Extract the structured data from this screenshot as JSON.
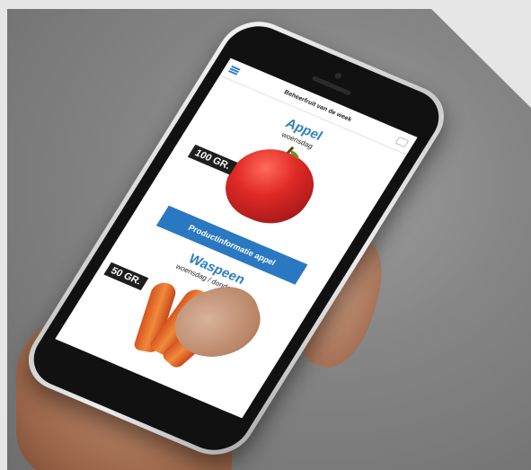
{
  "app": {
    "header_title": "Beheerfruit van de week",
    "menu_icon": "menu-icon",
    "share_icon": "share-icon"
  },
  "products": [
    {
      "name": "Appel",
      "days": "woensdag",
      "weight": "100 GR.",
      "image": "apple-image",
      "button_label": "Productinformatie appel"
    },
    {
      "name": "Waspeen",
      "days": "woensdag / donderdag",
      "weight": "50 GR.",
      "image": "carrot-image"
    }
  ],
  "colors": {
    "accent": "#2f7ec1",
    "button": "#2b78c2",
    "background": "#8c8c8c"
  }
}
